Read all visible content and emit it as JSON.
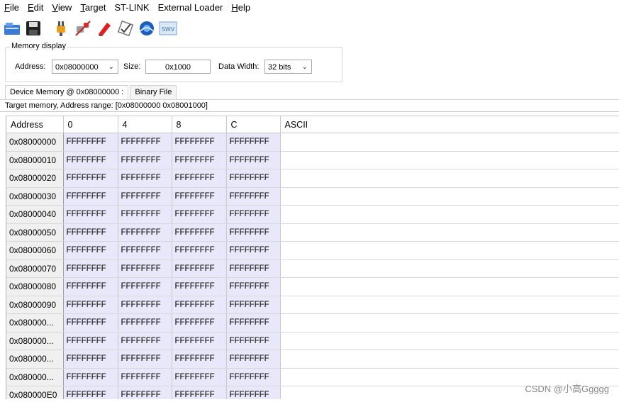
{
  "menu": {
    "items": [
      {
        "mnemonic": "F",
        "rest": "ile"
      },
      {
        "mnemonic": "E",
        "rest": "dit"
      },
      {
        "mnemonic": "V",
        "rest": "iew"
      },
      {
        "mnemonic": "T",
        "rest": "arget"
      },
      {
        "mnemonic": "",
        "rest": "ST-LINK"
      },
      {
        "mnemonic": "",
        "rest": "External Loader"
      },
      {
        "mnemonic": "H",
        "rest": "elp"
      }
    ]
  },
  "toolbar": {
    "icons": [
      "open-file-icon",
      "save-icon",
      "connect-plug-icon",
      "disconnect-plug-icon",
      "erase-pen-icon",
      "program-verify-icon",
      "mcu-core-icon",
      "swv-icon"
    ],
    "swv_label": "SWV"
  },
  "memory_display": {
    "title": "Memory display",
    "address_label": "Address:",
    "address_value": "0x08000000",
    "size_label": "Size:",
    "size_value": "0x1000",
    "width_label": "Data Width:",
    "width_value": "32 bits"
  },
  "tabs": [
    {
      "label": "Device Memory @ 0x08000000 :",
      "active": true
    },
    {
      "label": "Binary File",
      "active": false
    }
  ],
  "range_text": "Target memory, Address range: [0x08000000 0x08001000]",
  "table": {
    "headers": [
      "Address",
      "0",
      "4",
      "8",
      "C",
      "ASCII"
    ],
    "rows": [
      {
        "addr": "0x08000000",
        "cells": [
          "FFFFFFFF",
          "FFFFFFFF",
          "FFFFFFFF",
          "FFFFFFFF"
        ]
      },
      {
        "addr": "0x08000010",
        "cells": [
          "FFFFFFFF",
          "FFFFFFFF",
          "FFFFFFFF",
          "FFFFFFFF"
        ]
      },
      {
        "addr": "0x08000020",
        "cells": [
          "FFFFFFFF",
          "FFFFFFFF",
          "FFFFFFFF",
          "FFFFFFFF"
        ]
      },
      {
        "addr": "0x08000030",
        "cells": [
          "FFFFFFFF",
          "FFFFFFFF",
          "FFFFFFFF",
          "FFFFFFFF"
        ]
      },
      {
        "addr": "0x08000040",
        "cells": [
          "FFFFFFFF",
          "FFFFFFFF",
          "FFFFFFFF",
          "FFFFFFFF"
        ]
      },
      {
        "addr": "0x08000050",
        "cells": [
          "FFFFFFFF",
          "FFFFFFFF",
          "FFFFFFFF",
          "FFFFFFFF"
        ]
      },
      {
        "addr": "0x08000060",
        "cells": [
          "FFFFFFFF",
          "FFFFFFFF",
          "FFFFFFFF",
          "FFFFFFFF"
        ]
      },
      {
        "addr": "0x08000070",
        "cells": [
          "FFFFFFFF",
          "FFFFFFFF",
          "FFFFFFFF",
          "FFFFFFFF"
        ]
      },
      {
        "addr": "0x08000080",
        "cells": [
          "FFFFFFFF",
          "FFFFFFFF",
          "FFFFFFFF",
          "FFFFFFFF"
        ]
      },
      {
        "addr": "0x08000090",
        "cells": [
          "FFFFFFFF",
          "FFFFFFFF",
          "FFFFFFFF",
          "FFFFFFFF"
        ]
      },
      {
        "addr": "0x080000...",
        "cells": [
          "FFFFFFFF",
          "FFFFFFFF",
          "FFFFFFFF",
          "FFFFFFFF"
        ]
      },
      {
        "addr": "0x080000...",
        "cells": [
          "FFFFFFFF",
          "FFFFFFFF",
          "FFFFFFFF",
          "FFFFFFFF"
        ]
      },
      {
        "addr": "0x080000...",
        "cells": [
          "FFFFFFFF",
          "FFFFFFFF",
          "FFFFFFFF",
          "FFFFFFFF"
        ]
      },
      {
        "addr": "0x080000...",
        "cells": [
          "FFFFFFFF",
          "FFFFFFFF",
          "FFFFFFFF",
          "FFFFFFFF"
        ]
      },
      {
        "addr": "0x080000E0",
        "cells": [
          "FFFFFFFF",
          "FFFFFFFF",
          "FFFFFFFF",
          "FFFFFFFF"
        ]
      }
    ]
  },
  "watermark": "CSDN @小高Ggggg",
  "colors": {
    "data_cell_bg": "#e8e8fa",
    "address_cell_bg": "#f0f0f0"
  }
}
